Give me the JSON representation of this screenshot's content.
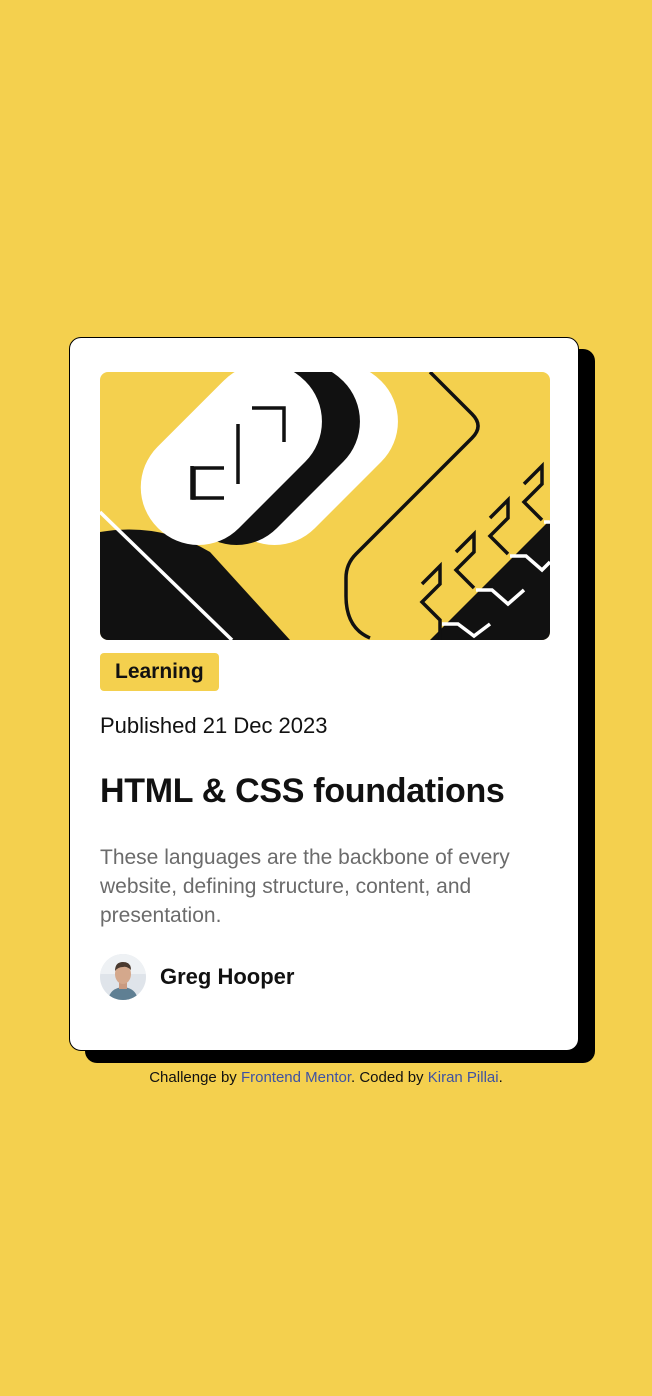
{
  "colors": {
    "background": "#f4d04e",
    "card": "#ffffff",
    "text": "#111111",
    "muted": "#6b6b6b",
    "link": "#3e52a3"
  },
  "card": {
    "illustration_icon": "illustration-article",
    "tag": "Learning",
    "published": "Published 21 Dec 2023",
    "title": "HTML & CSS foundations",
    "description": "These languages are the backbone of every website, defining structure, content, and presentation.",
    "author": {
      "avatar_icon": "avatar-image",
      "name": "Greg Hooper"
    }
  },
  "footer": {
    "prefix": "Challenge by ",
    "link1": "Frontend Mentor",
    "middle": ". Coded by ",
    "link2": "Kiran Pillai",
    "suffix": "."
  }
}
